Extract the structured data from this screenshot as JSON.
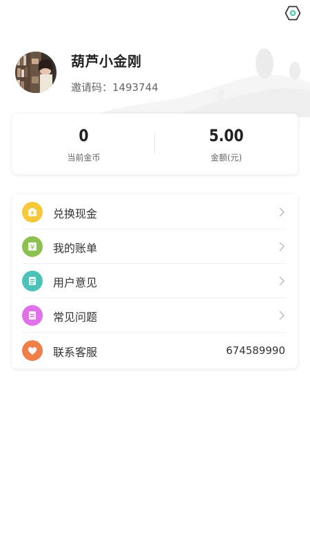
{
  "header": {
    "settings_icon": "settings-hexagon-icon",
    "accent_color": "#3ec9a7"
  },
  "profile": {
    "nickname": "葫芦小金刚",
    "invite_text": "邀请码：1493744"
  },
  "stats": {
    "coins_value": "0",
    "coins_label": "当前金币",
    "amount_value": "5.00",
    "amount_label": "金额(元)"
  },
  "menu": {
    "items": [
      {
        "label": "兑换现金",
        "icon": "wallet-icon",
        "color": "#f5c93a"
      },
      {
        "label": "我的账单",
        "icon": "yuan-bill-icon",
        "color": "#8cc152"
      },
      {
        "label": "用户意见",
        "icon": "feedback-icon",
        "color": "#4dc3b8"
      },
      {
        "label": "常见问题",
        "icon": "faq-icon",
        "color": "#e071e8"
      },
      {
        "label": "联系客服",
        "icon": "heart-icon",
        "color": "#ee7f4a",
        "value": "674589990"
      }
    ]
  }
}
